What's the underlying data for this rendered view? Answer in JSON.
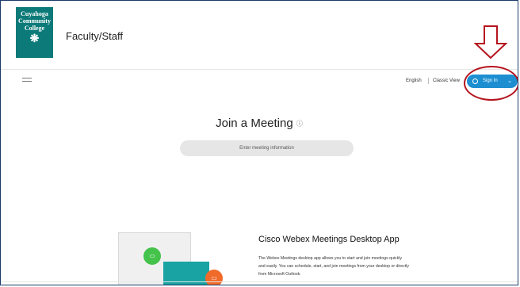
{
  "header": {
    "logo_text": "Cuyahoga Community College",
    "logo_line1": "Cuyahoga",
    "logo_line2": "Community",
    "logo_line3": "College",
    "department": "Faculty/Staff"
  },
  "toolbar": {
    "language": "English",
    "classic_view": "Classic View",
    "sign_in": "Sign In"
  },
  "main": {
    "title": "Join a Meeting",
    "search_placeholder": "Enter meeting information"
  },
  "promo": {
    "title": "Cisco Webex Meetings Desktop App",
    "description": "The Webex Meetings desktop app allows you to start and join meetings quickly and easily. You can schedule, start, and join meetings from your desktop or directly from Microsoft Outlook."
  },
  "colors": {
    "brand_teal": "#0b7a78",
    "sign_in_blue": "#1d8fd1",
    "annotation_red": "#b5141e"
  },
  "icons": {
    "menu": "hamburger-menu-icon",
    "user": "user-icon",
    "chevron": "chevron-down-icon",
    "info": "info-icon",
    "annotation": "down-arrow-annotation"
  }
}
